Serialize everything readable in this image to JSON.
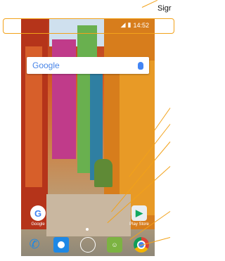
{
  "annotation": {
    "label": "Sigr"
  },
  "status_bar": {
    "time": "14:52",
    "icons": [
      "signal-icon",
      "battery-icon"
    ]
  },
  "search": {
    "brand": "Google",
    "icon": "mic-icon"
  },
  "home_apps": [
    {
      "label": "Google",
      "icon": "google-icon"
    },
    {
      "label": "Play Store",
      "icon": "play-store-icon"
    }
  ],
  "dock": [
    {
      "icon": "phone-icon"
    },
    {
      "icon": "contacts-icon"
    },
    {
      "icon": "camera-icon"
    },
    {
      "icon": "messaging-icon"
    },
    {
      "icon": "chrome-icon"
    }
  ],
  "colors": {
    "annotation": "#f2a21a",
    "google_blue": "#4285f4"
  }
}
